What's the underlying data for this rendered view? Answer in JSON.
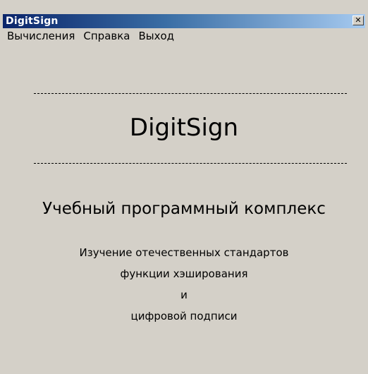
{
  "window": {
    "title": "DigitSign",
    "close_glyph": "✕"
  },
  "menu": {
    "items": [
      {
        "label": "Вычисления"
      },
      {
        "label": "Справка"
      },
      {
        "label": "Выход"
      }
    ]
  },
  "content": {
    "app_name": "DigitSign",
    "subtitle": "Учебный программный комплекс",
    "description": [
      "Изучение отечественных стандартов",
      "функции хэширования",
      "и",
      "цифровой подписи"
    ]
  },
  "colors": {
    "titlebar_start": "#0a246a",
    "titlebar_end": "#a6caf0",
    "window_bg": "#d4d0c8"
  }
}
